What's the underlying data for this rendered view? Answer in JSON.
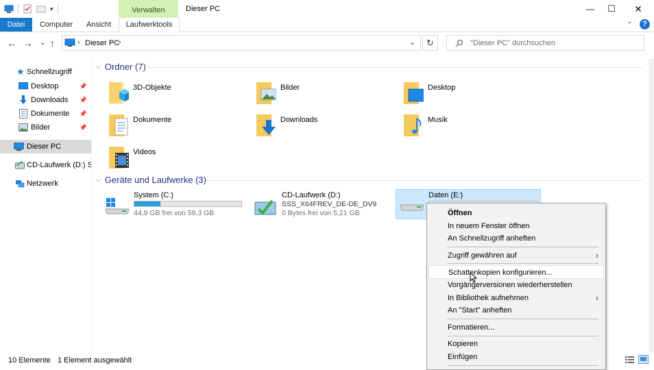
{
  "window": {
    "title": "Dieser PC",
    "context_tab_group": "Verwalten",
    "minimize": "—",
    "maximize": "☐",
    "close": "✕"
  },
  "ribbon": {
    "tabs": [
      "Datei",
      "Computer",
      "Ansicht",
      "Laufwerktools"
    ],
    "expand_icon": "⌄",
    "help": "?"
  },
  "address": {
    "back": "←",
    "forward": "→",
    "recent": "⌄",
    "up": "↑",
    "separator": "›",
    "crumb": "Dieser PC",
    "dropdown": "⌄",
    "refresh": "↻",
    "search_placeholder": "\"Dieser PC\" durchsuchen"
  },
  "sidebar": {
    "quick_access": "Schnellzugriff",
    "items": [
      {
        "label": "Desktop"
      },
      {
        "label": "Downloads"
      },
      {
        "label": "Dokumente"
      },
      {
        "label": "Bilder"
      }
    ],
    "this_pc": "Dieser PC",
    "cd_drive": "CD-Laufwerk (D:) SSS",
    "network": "Netzwerk"
  },
  "main": {
    "folders_header": "Ordner (7)",
    "folders": [
      {
        "label": "3D-Objekte",
        "icon": "3d-objects-folder-icon"
      },
      {
        "label": "Bilder",
        "icon": "pictures-folder-icon"
      },
      {
        "label": "Desktop",
        "icon": "desktop-folder-icon"
      },
      {
        "label": "Dokumente",
        "icon": "documents-folder-icon"
      },
      {
        "label": "Downloads",
        "icon": "downloads-folder-icon"
      },
      {
        "label": "Musik",
        "icon": "music-folder-icon"
      },
      {
        "label": "Videos",
        "icon": "videos-folder-icon"
      }
    ],
    "devices_header": "Geräte und Laufwerke (3)",
    "drives": [
      {
        "name": "System (C:)",
        "sub": "44,9 GB frei von 59,3 GB",
        "used_fraction": 0.243
      },
      {
        "name": "CD-Laufwerk (D:)",
        "sub2": "SSS_X64FREV_DE-DE_DV9",
        "sub": "0 Bytes frei von 5,21 GB"
      },
      {
        "name": "Daten (E:)"
      }
    ]
  },
  "status": {
    "count": "10 Elemente",
    "selection": "1 Element ausgewählt"
  },
  "context_menu": {
    "items": [
      {
        "label": "Öffnen"
      },
      {
        "label": "In neuem Fenster öffnen"
      },
      {
        "label": "An Schnellzugriff anheften"
      },
      {
        "label": "Zugriff gewähren auf"
      },
      {
        "label": "Schattenkopien konfigurieren..."
      },
      {
        "label": "Vorgängerversionen wiederherstellen"
      },
      {
        "label": "In Bibliothek aufnehmen"
      },
      {
        "label": "An \"Start\" anheften"
      },
      {
        "label": "Formatieren..."
      },
      {
        "label": "Kopieren"
      },
      {
        "label": "Einfügen"
      }
    ],
    "submenu_arrow": "›"
  },
  "colors": {
    "accent": "#1979ca",
    "context_tab": "#d2f1b4",
    "selection": "#cce8ff",
    "progress": "#26a0da",
    "group_header": "#1e3287"
  }
}
